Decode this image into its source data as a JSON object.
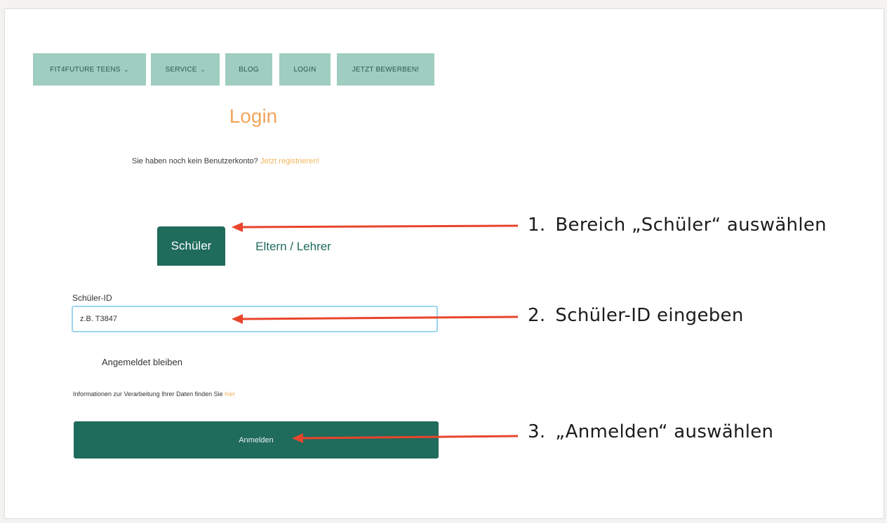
{
  "nav": {
    "items": [
      {
        "label": "FIT4FUTURE TEENS",
        "caret": "⌄"
      },
      {
        "label": "SERVICE",
        "caret": "⌄"
      },
      {
        "label": "BLOG"
      },
      {
        "label": "LOGIN"
      },
      {
        "label": "JETZT BEWERBEN!"
      }
    ]
  },
  "login": {
    "title": "Login",
    "register_prompt": "Sie haben noch kein Benutzerkonto?",
    "register_link": "Jetzt registrieren!",
    "tabs": {
      "active": "Schüler",
      "inactive": "Eltern / Lehrer"
    },
    "id_label": "Schüler-ID",
    "id_value": "z.B. T3847",
    "remember_label": "Angemeldet bleiben",
    "privacy_text": "Informationen zur Verarbeitung Ihrer Daten finden Sie",
    "privacy_link": "hier",
    "submit_label": "Anmelden"
  },
  "annotations": [
    {
      "number": "1.",
      "text": "Bereich „Schüler“ auswählen"
    },
    {
      "number": "2.",
      "text": "Schüler-ID eingeben"
    },
    {
      "number": "3.",
      "text": "„Anmelden“ auswählen"
    }
  ],
  "colors": {
    "nav_bg": "#9fcdbf",
    "primary": "#1f6b5c",
    "accent_orange": "#f2a55b",
    "arrow_red": "#e8452c",
    "input_border": "#9dd4ee"
  }
}
